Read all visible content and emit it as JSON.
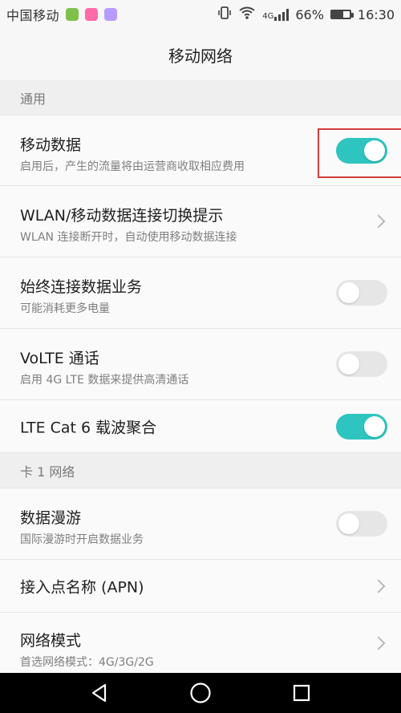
{
  "status_bar": {
    "carrier": "中国移动",
    "network_type": "4G",
    "battery_percent_text": "66%",
    "battery_level": 0.66,
    "time": "16:30",
    "icons": [
      "app-icon-green",
      "app-icon-pink",
      "app-icon-purple",
      "vibrate-icon",
      "wifi-icon",
      "signal-icon",
      "battery-icon"
    ]
  },
  "page": {
    "title": "移动网络"
  },
  "sections": {
    "general": {
      "header": "通用"
    },
    "card1": {
      "header": "卡 1 网络"
    }
  },
  "rows": {
    "mobile_data": {
      "title": "移动数据",
      "subtitle": "启用后，产生的流量将由运营商收取相应费用",
      "state": "on"
    },
    "wlan_switch": {
      "title": "WLAN/移动数据连接切换提示",
      "subtitle": "WLAN 连接断开时，自动使用移动数据连接"
    },
    "always_on": {
      "title": "始终连接数据业务",
      "subtitle": "可能消耗更多电量",
      "state": "off"
    },
    "volte": {
      "title": "VoLTE 通话",
      "subtitle": "启用 4G LTE 数据来提供高清通话",
      "state": "off"
    },
    "lte_cat6": {
      "title": "LTE Cat 6 载波聚合",
      "state": "on"
    },
    "roaming": {
      "title": "数据漫游",
      "subtitle": "国际漫游时开启数据业务",
      "state": "off"
    },
    "apn": {
      "title": "接入点名称 (APN)"
    },
    "network_mode": {
      "title": "网络模式",
      "subtitle": "首选网络模式：4G/3G/2G"
    }
  },
  "colors": {
    "accent": "#2ec4c0",
    "highlight": "#d33b3b",
    "toggle_off": "#e6e6e6"
  },
  "nav": {
    "icons": [
      "back-triangle-icon",
      "home-circle-icon",
      "recent-square-icon"
    ]
  }
}
